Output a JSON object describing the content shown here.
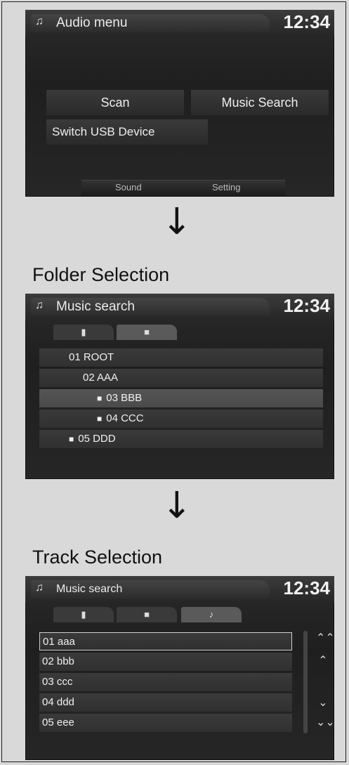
{
  "screens": {
    "audio_menu": {
      "title": "Audio menu",
      "clock": "12:34",
      "scan": "Scan",
      "music_search": "Music Search",
      "switch_usb": "Switch USB Device",
      "sound": "Sound",
      "setting": "Setting"
    },
    "folder": {
      "title": "Music search",
      "clock": "12:34",
      "rows": [
        "01 ROOT",
        "02 AAA",
        "03 BBB",
        "04 CCC",
        "05 DDD"
      ]
    },
    "track": {
      "title": "Music search",
      "clock": "12:34",
      "rows": [
        "01 aaa",
        "02 bbb",
        "03 ccc",
        "04 ddd",
        "05 eee"
      ]
    }
  },
  "labels": {
    "folder_selection": "Folder Selection",
    "track_selection": "Track Selection"
  },
  "icons": {
    "note": "music-note-icon",
    "usb": "usb-icon",
    "folder": "folder-icon",
    "track": "single-note-icon",
    "arrow": "down-arrow-icon"
  }
}
